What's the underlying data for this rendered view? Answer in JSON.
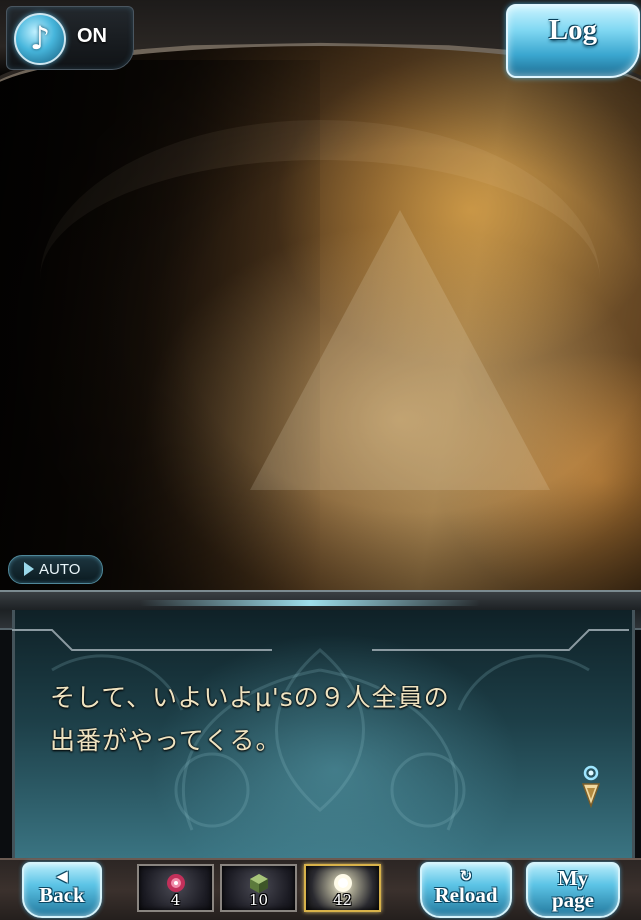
{
  "sound": {
    "state_label": "ON",
    "icon": "music-note-icon"
  },
  "log": {
    "label": "Log"
  },
  "auto": {
    "label": "AUTO"
  },
  "dialogue": {
    "lines": [
      "そして、いよいよμ'sの９人全員の",
      "出番がやってくる。"
    ]
  },
  "nav": {
    "back": {
      "symbol": "◀",
      "label": "Back"
    },
    "reload": {
      "symbol": "↻",
      "label": "Reload"
    },
    "mypage": {
      "label_line1": "My",
      "label_line2": "page"
    }
  },
  "items": [
    {
      "icon": "red-flower-item-icon",
      "count": "4"
    },
    {
      "icon": "green-cube-item-icon",
      "count": "10"
    },
    {
      "icon": "light-orb-item-icon",
      "count": "42"
    }
  ],
  "colors": {
    "accent": "#5cc4e6",
    "dialogue_text": "#efe3c0",
    "frame": "#3a3f43"
  }
}
